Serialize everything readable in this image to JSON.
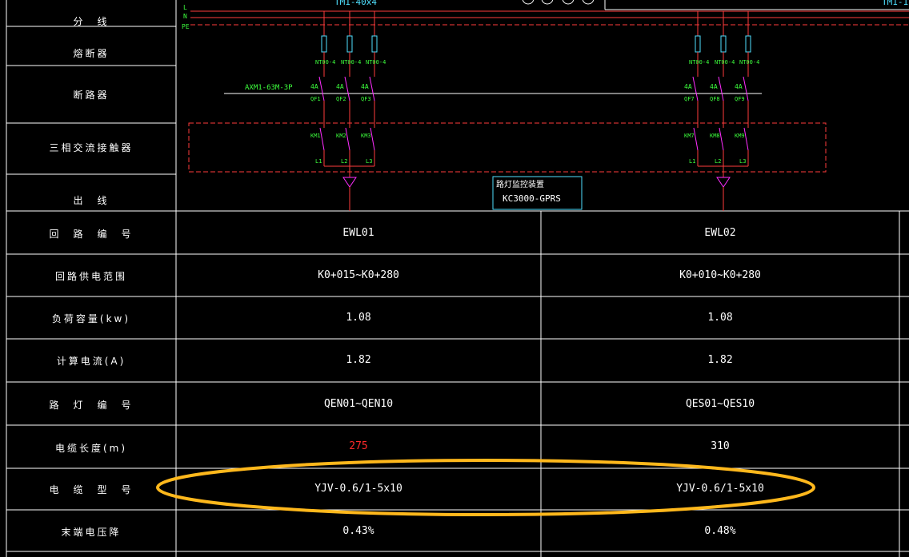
{
  "top": {
    "bus_label_1": "TM1-40x4",
    "bus_label_2": "TM1-1",
    "phase_l": "L",
    "phase_n": "N",
    "phase_pe": "PE"
  },
  "row_labels": [
    "分　线",
    "熔断器",
    "断路器",
    "三相交流接触器",
    "出　线"
  ],
  "schematic": {
    "breaker_model": "AXM1-63M-3P",
    "fuse_label": "NT00-4",
    "breaker_rating": "4A",
    "group1": {
      "qf": [
        "QF1",
        "QF2",
        "QF3"
      ],
      "km": [
        "KM1",
        "KM2",
        "KM3"
      ],
      "phases": [
        "L1",
        "L2",
        "L3"
      ]
    },
    "group2": {
      "qf": [
        "QF7",
        "QF8",
        "QF9"
      ],
      "km": [
        "KM7",
        "KM8",
        "KM9"
      ],
      "phases": [
        "L1",
        "L2",
        "L3"
      ]
    },
    "monitor_title": "路灯监控装置",
    "monitor_model": "KC3000-GPRS"
  },
  "table": {
    "rows": [
      {
        "label": "回　路　编　号",
        "c1": "EWL01",
        "c2": "EWL02"
      },
      {
        "label": "回路供电范围",
        "c1": "K0+015~K0+280",
        "c2": "K0+010~K0+280"
      },
      {
        "label": "负荷容量(kw)",
        "c1": "1.08",
        "c2": "1.08"
      },
      {
        "label": "计算电流(A)",
        "c1": "1.82",
        "c2": "1.82"
      },
      {
        "label": "路　灯　编　号",
        "c1": "QEN01~QEN10",
        "c2": "QES01~QES10"
      },
      {
        "label": "电缆长度(m)",
        "c1": "275",
        "c2": "310"
      },
      {
        "label": "电　缆　型　号",
        "c1": "YJV-0.6/1-5x10",
        "c2": "YJV-0.6/1-5x10"
      },
      {
        "label": "末端电压降",
        "c1": "0.43%",
        "c2": "0.48%"
      }
    ]
  },
  "colors": {
    "phase_line": "#ff3b3b",
    "pe_line": "#ff3b3b",
    "breaker": "#ff2dff",
    "fuse": "#4fe0ff",
    "label_green": "#3dff3d",
    "highlight": "#ffb81c",
    "warn_value": "#ff2a2a",
    "grid": "#ffffff"
  }
}
